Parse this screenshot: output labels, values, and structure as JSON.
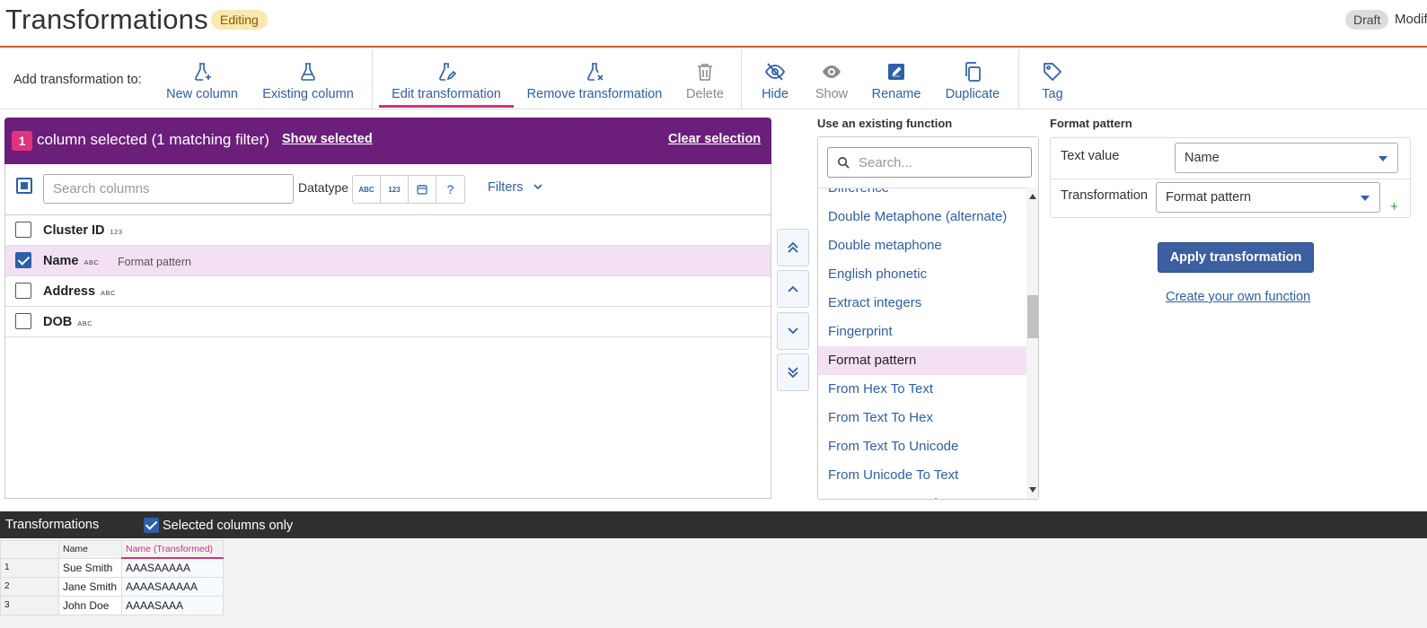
{
  "header": {
    "title": "Transformations",
    "status_badge": "Editing",
    "draft_badge": "Draft",
    "modified_text": "Modif"
  },
  "toolbar": {
    "add_label": "Add transformation to:",
    "new_column": "New column",
    "existing_column": "Existing column",
    "edit_transformation": "Edit transformation",
    "remove_transformation": "Remove transformation",
    "delete": "Delete",
    "hide": "Hide",
    "show": "Show",
    "rename": "Rename",
    "duplicate": "Duplicate",
    "tag": "Tag"
  },
  "selection": {
    "count": "1",
    "text": "column selected (1 matching filter)",
    "show_selected": "Show selected",
    "clear_selection": "Clear selection"
  },
  "filterbar": {
    "search_placeholder": "Search columns",
    "datatype_label": "Datatype",
    "dt_text": "ABC",
    "dt_number": "123",
    "dt_help": "?",
    "filters": "Filters"
  },
  "columns": [
    {
      "name": "Cluster ID",
      "type": "123",
      "transform": "",
      "checked": false
    },
    {
      "name": "Name",
      "type": "ABC",
      "transform": "Format pattern",
      "checked": true
    },
    {
      "name": "Address",
      "type": "ABC",
      "transform": "",
      "checked": false
    },
    {
      "name": "DOB",
      "type": "ABC",
      "transform": "",
      "checked": false
    }
  ],
  "functions": {
    "header": "Use an existing function",
    "search_placeholder": "Search...",
    "items": [
      "Difference",
      "Double Metaphone (alternate)",
      "Double metaphone",
      "English phonetic",
      "Extract integers",
      "Fingerprint",
      "Format pattern",
      "From Hex To Text",
      "From Text To Hex",
      "From Text To Unicode",
      "From Unicode To Text",
      "Lowercase Metaphone"
    ],
    "selected": "Format pattern"
  },
  "format_pattern": {
    "header": "Format pattern",
    "text_value_label": "Text value",
    "text_value": "Name",
    "transformation_label": "Transformation",
    "transformation_value": "Format pattern",
    "plus": "+",
    "apply_button": "Apply transformation",
    "create_link": "Create your own function"
  },
  "preview": {
    "title": "Transformations",
    "selected_only_label": "Selected columns only",
    "headers": [
      "Name",
      "Name (Transformed)"
    ],
    "rows": [
      {
        "n": "1",
        "name": "Sue Smith",
        "transformed": "AAASAAAAA"
      },
      {
        "n": "2",
        "name": "Jane Smith",
        "transformed": "AAAASAAAAA"
      },
      {
        "n": "3",
        "name": "John Doe",
        "transformed": "AAAASAAA"
      }
    ]
  }
}
